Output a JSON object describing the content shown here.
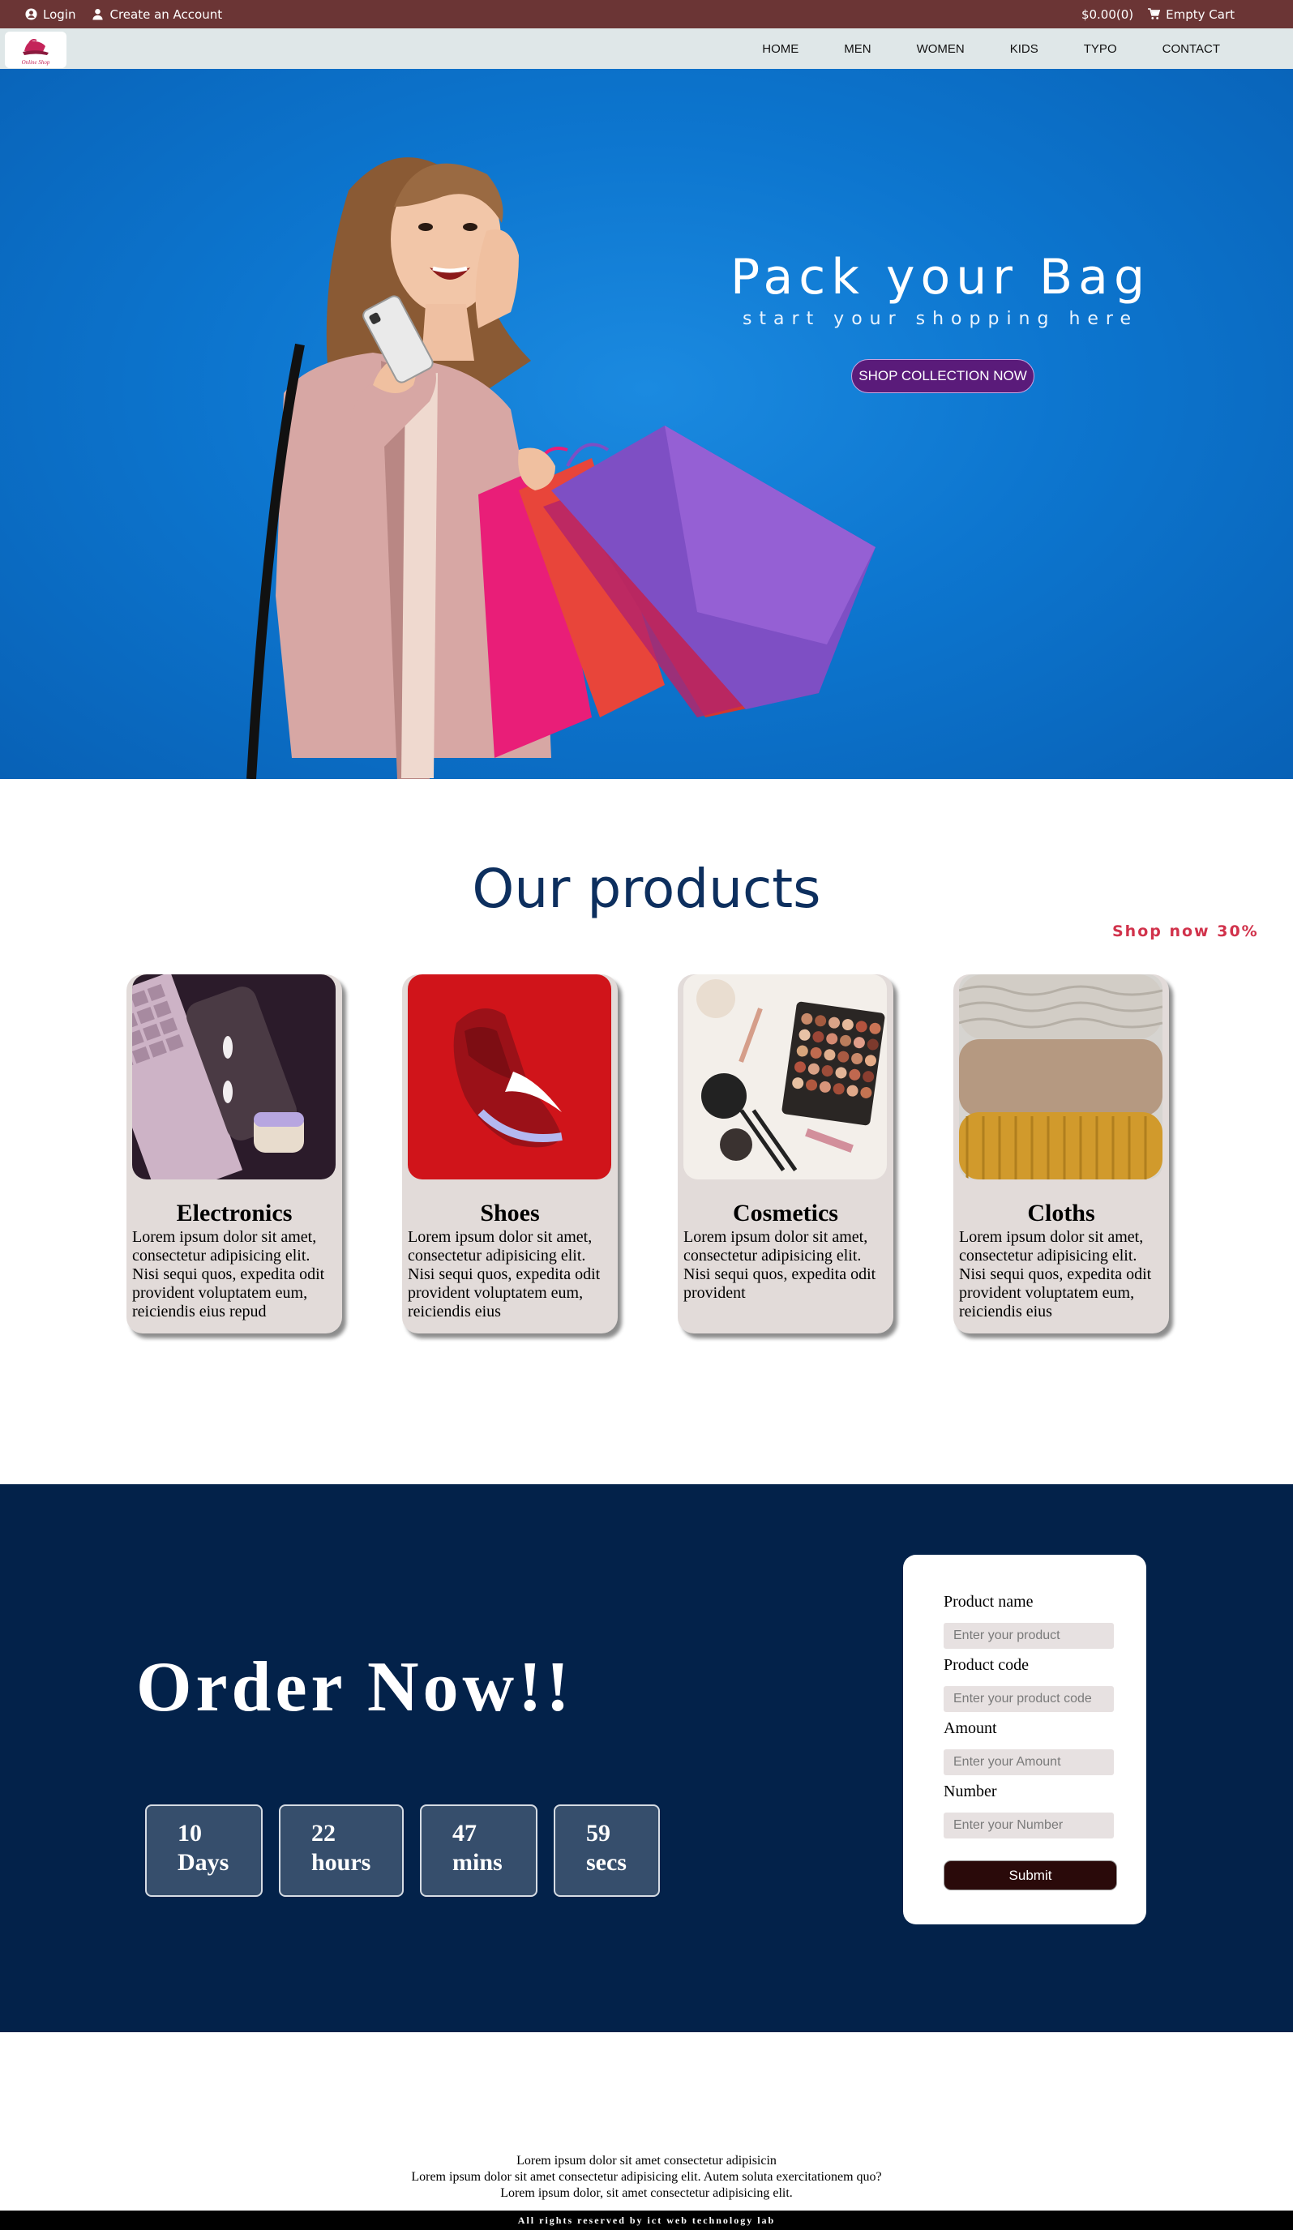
{
  "topbar": {
    "login": "Login",
    "create_account": "Create an Account",
    "cart_total": "$0.00(0)",
    "cart_label": "Empty Cart"
  },
  "logo": {
    "text": "Online Shop"
  },
  "nav": {
    "items": [
      "HOME",
      "MEN",
      "WOMEN",
      "KIDS",
      "TYPO",
      "CONTACT"
    ]
  },
  "hero": {
    "title": "Pack your Bag",
    "subtitle": "start your shopping here",
    "button": "SHOP COLLECTION NOW"
  },
  "products": {
    "title": "Our products",
    "promo": "Shop now 30%",
    "cards": [
      {
        "name": "Electronics",
        "desc": "Lorem ipsum dolor sit amet, consectetur adipisicing elit. Nisi sequi quos, expedita odit provident voluptatem eum, reiciendis eius repud"
      },
      {
        "name": "Shoes",
        "desc": "Lorem ipsum dolor sit amet, consectetur adipisicing elit. Nisi sequi quos, expedita odit provident voluptatem eum, reiciendis eius"
      },
      {
        "name": "Cosmetics",
        "desc": "Lorem ipsum dolor sit amet, consectetur adipisicing elit. Nisi sequi quos, expedita odit provident"
      },
      {
        "name": "Cloths",
        "desc": "Lorem ipsum dolor sit amet, consectetur adipisicing elit. Nisi sequi quos, expedita odit provident voluptatem eum, reiciendis eius"
      }
    ]
  },
  "order": {
    "title": "Order Now!!",
    "countdown": [
      {
        "value": "10",
        "unit": "Days"
      },
      {
        "value": "22",
        "unit": "hours"
      },
      {
        "value": "47",
        "unit": "mins"
      },
      {
        "value": "59",
        "unit": "secs"
      }
    ],
    "form": {
      "product_name_label": "Product name",
      "product_name_placeholder": "Enter your product",
      "product_code_label": "Product code",
      "product_code_placeholder": "Enter your product code",
      "amount_label": "Amount",
      "amount_placeholder": "Enter your Amount",
      "number_label": "Number",
      "number_placeholder": "Enter your Number",
      "submit": "Submit"
    }
  },
  "footer": {
    "line1": "Lorem ipsum dolor sit amet consectetur adipisicin",
    "line2": "Lorem ipsum dolor sit amet consectetur adipisicing elit. Autem soluta exercitationem quo?",
    "line3": "Lorem ipsum dolor, sit amet consectetur adipisicing elit.",
    "copyright": "All rights reserved by ict web technology lab"
  }
}
